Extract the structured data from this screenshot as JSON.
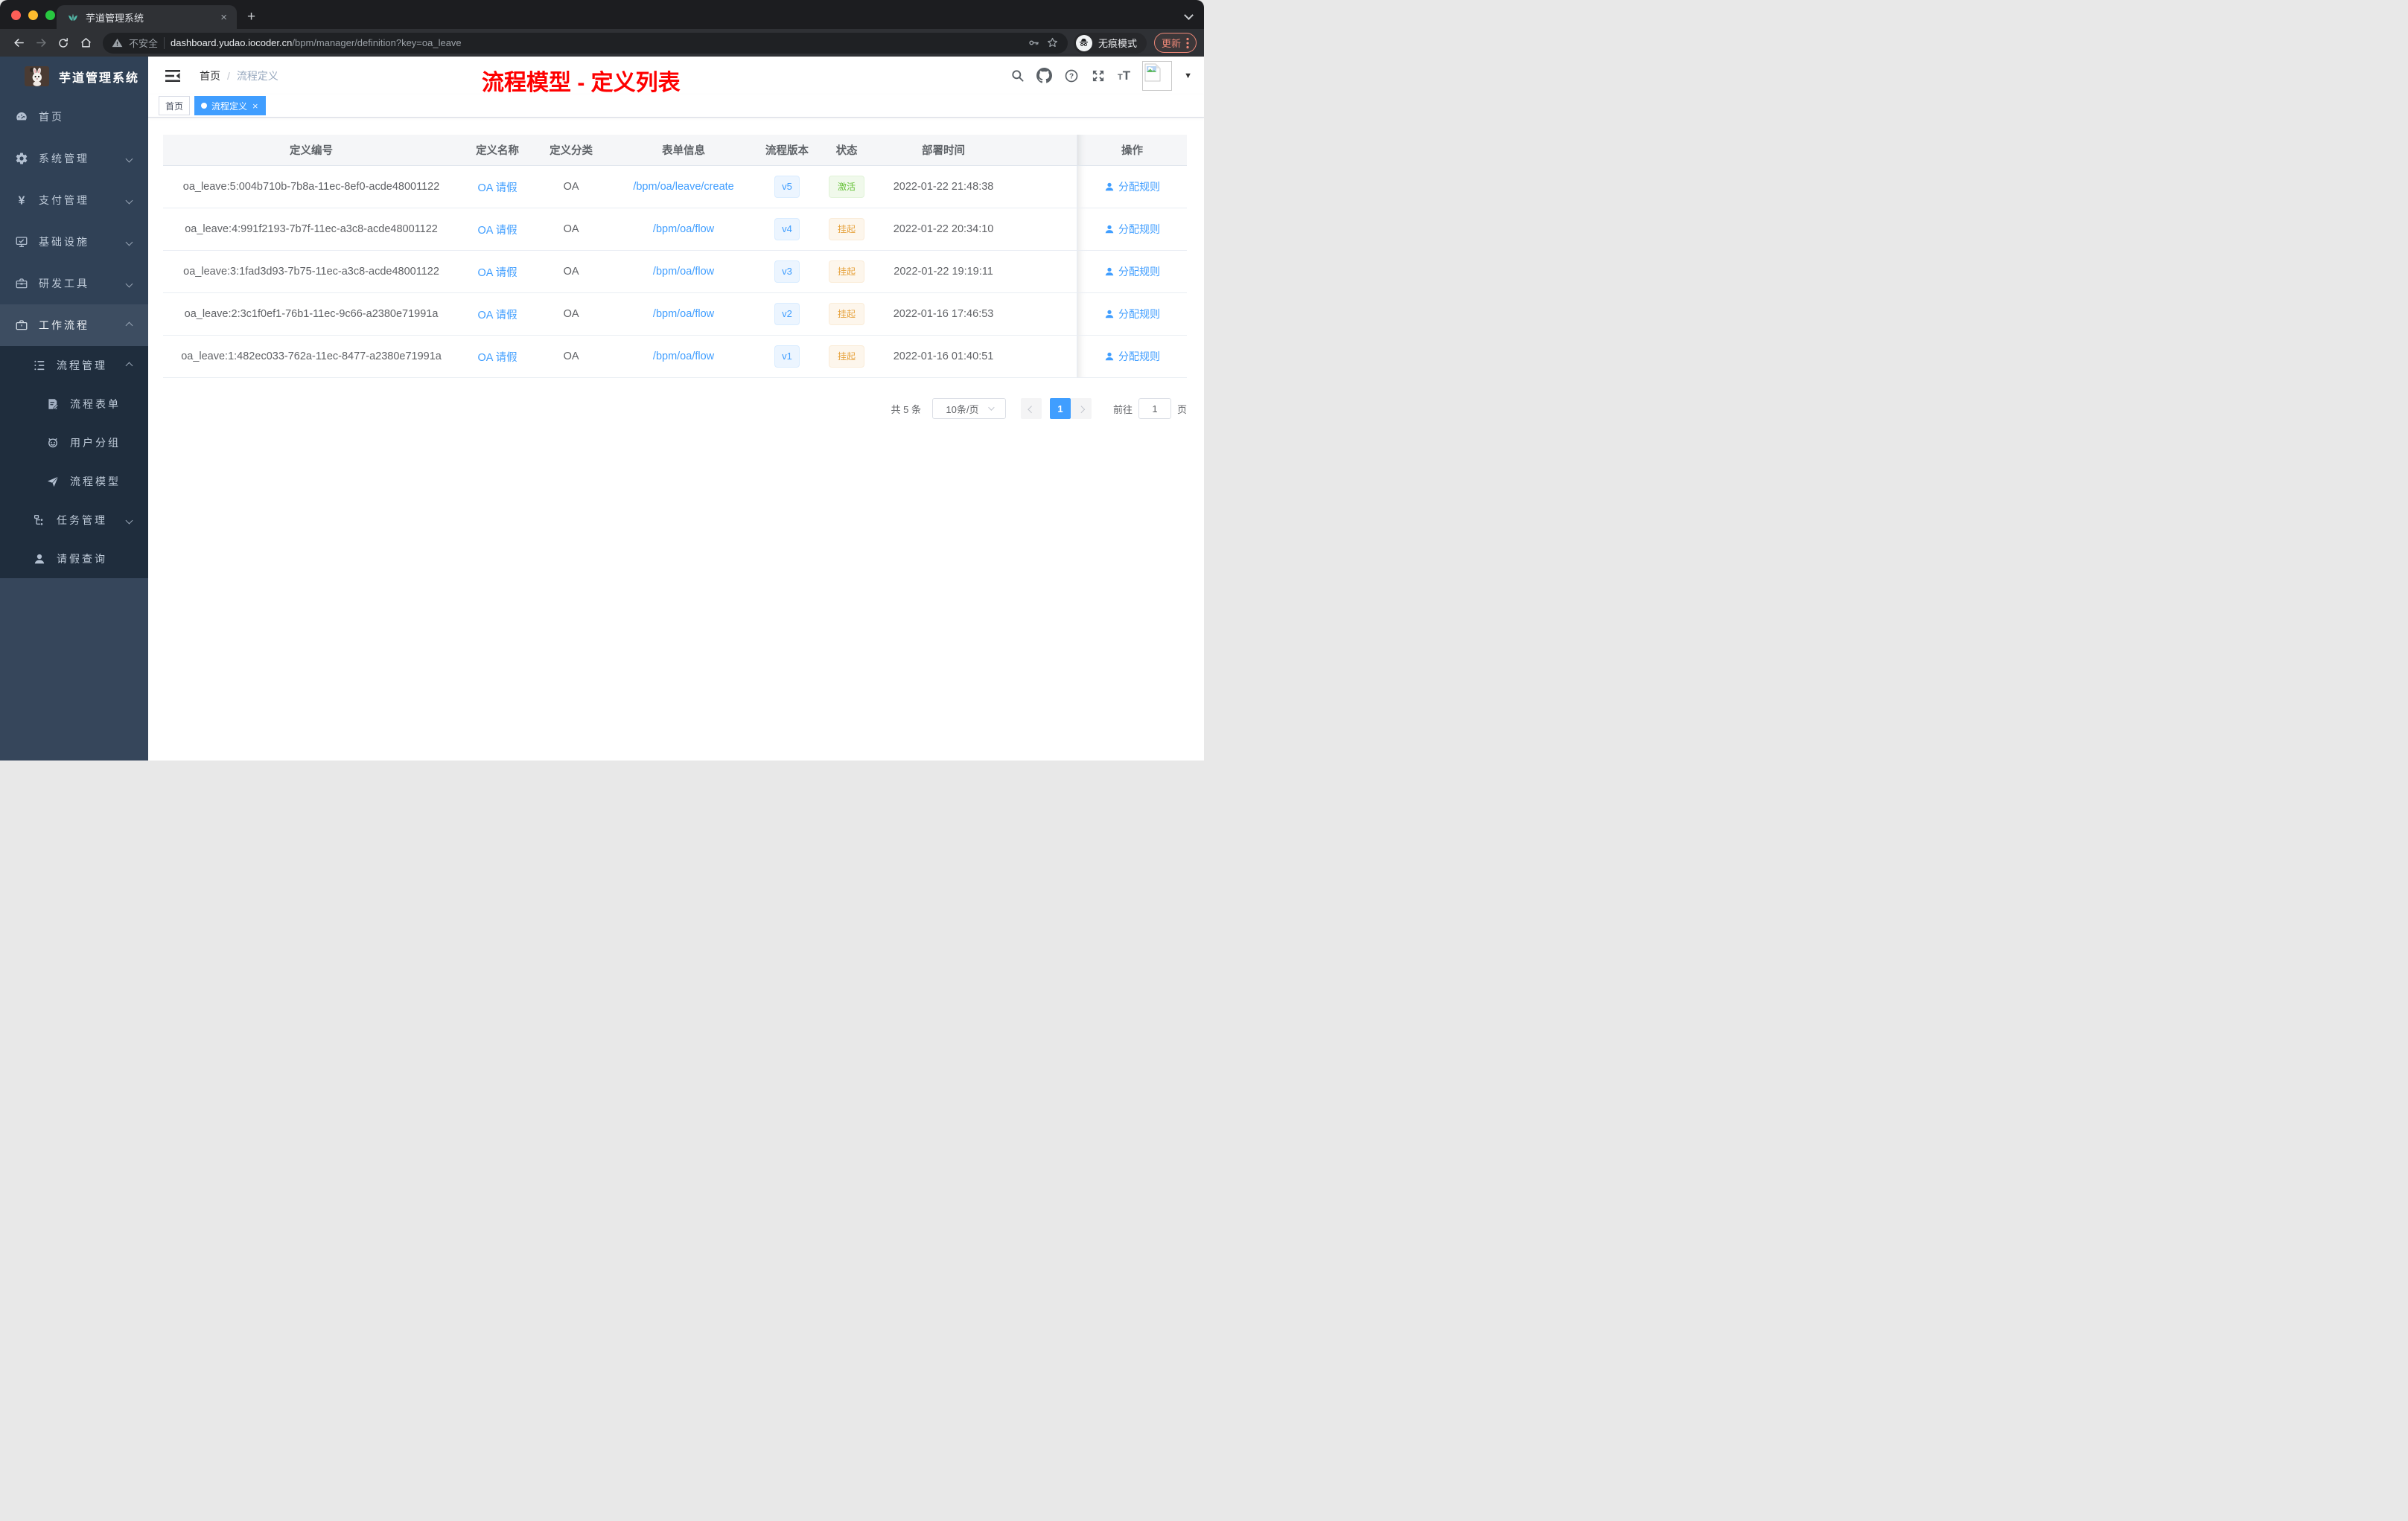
{
  "colors": {
    "accent": "#409eff",
    "annotation": "#fe0000",
    "sidebar_bg": "#304156",
    "submenu_bg": "#1f2d3d",
    "success": "#67c23a",
    "warning": "#e6a23c"
  },
  "browser": {
    "tab": {
      "title": "芋道管理系统",
      "close": "×"
    },
    "new_tab": "+",
    "url": {
      "security": "不安全",
      "host": "dashboard.yudao.iocoder.cn",
      "path": "/bpm/manager/definition?key=oa_leave"
    },
    "incognito_label": "无痕模式",
    "update_label": "更新"
  },
  "app": {
    "logo_title": "芋道管理系统",
    "breadcrumb": {
      "home": "首页",
      "separator": "/",
      "current": "流程定义"
    },
    "annotation": "流程模型 - 定义列表",
    "tags": [
      {
        "key": "home",
        "label": "首页",
        "active": false
      },
      {
        "key": "process-definition",
        "label": "流程定义",
        "active": true,
        "close": "×"
      }
    ]
  },
  "sidebar": {
    "items": [
      {
        "key": "home",
        "icon": "dashboard",
        "label": "首页"
      },
      {
        "key": "system",
        "icon": "gear",
        "label": "系统管理",
        "chevron": "down"
      },
      {
        "key": "payment",
        "icon": "yen",
        "label": "支付管理",
        "chevron": "down"
      },
      {
        "key": "infrastructure",
        "icon": "monitor",
        "label": "基础设施",
        "chevron": "down"
      },
      {
        "key": "devtools",
        "icon": "toolbox",
        "label": "研发工具",
        "chevron": "down"
      },
      {
        "key": "workflow",
        "icon": "briefcase",
        "label": "工作流程",
        "chevron": "up",
        "highlight": true,
        "children": [
          {
            "key": "process-management",
            "icon": "tree-list",
            "label": "流程管理",
            "chevron": "up",
            "children": [
              {
                "key": "process-form",
                "icon": "form",
                "label": "流程表单"
              },
              {
                "key": "user-group",
                "icon": "robot",
                "label": "用户分组"
              },
              {
                "key": "process-model",
                "icon": "send",
                "label": "流程模型"
              }
            ]
          },
          {
            "key": "task-management",
            "icon": "tree",
            "label": "任务管理",
            "chevron": "down"
          },
          {
            "key": "leave-query",
            "icon": "user",
            "label": "请假查询"
          }
        ]
      }
    ]
  },
  "table": {
    "columns": [
      {
        "key": "id",
        "label": "定义编号"
      },
      {
        "key": "name",
        "label": "定义名称"
      },
      {
        "key": "category",
        "label": "定义分类"
      },
      {
        "key": "form",
        "label": "表单信息"
      },
      {
        "key": "version",
        "label": "流程版本"
      },
      {
        "key": "status",
        "label": "状态"
      },
      {
        "key": "deploy-time",
        "label": "部署时间"
      },
      {
        "key": "actions",
        "label": "操作"
      }
    ],
    "rows": [
      {
        "id": "oa_leave:5:004b710b-7b8a-11ec-8ef0-acde48001122",
        "name": "OA 请假",
        "category": "OA",
        "form": "/bpm/oa/leave/create",
        "version": "v5",
        "status": "激活",
        "status_type": "success",
        "deployed_at": "2022-01-22 21:48:38",
        "action": "分配规则"
      },
      {
        "id": "oa_leave:4:991f2193-7b7f-11ec-a3c8-acde48001122",
        "name": "OA 请假",
        "category": "OA",
        "form": "/bpm/oa/flow",
        "version": "v4",
        "status": "挂起",
        "status_type": "warning",
        "deployed_at": "2022-01-22 20:34:10",
        "action": "分配规则"
      },
      {
        "id": "oa_leave:3:1fad3d93-7b75-11ec-a3c8-acde48001122",
        "name": "OA 请假",
        "category": "OA",
        "form": "/bpm/oa/flow",
        "version": "v3",
        "status": "挂起",
        "status_type": "warning",
        "deployed_at": "2022-01-22 19:19:11",
        "action": "分配规则"
      },
      {
        "id": "oa_leave:2:3c1f0ef1-76b1-11ec-9c66-a2380e71991a",
        "name": "OA 请假",
        "category": "OA",
        "form": "/bpm/oa/flow",
        "version": "v2",
        "status": "挂起",
        "status_type": "warning",
        "deployed_at": "2022-01-16 17:46:53",
        "action": "分配规则"
      },
      {
        "id": "oa_leave:1:482ec033-762a-11ec-8477-a2380e71991a",
        "name": "OA 请假",
        "category": "OA",
        "form": "/bpm/oa/flow",
        "version": "v1",
        "status": "挂起",
        "status_type": "warning",
        "deployed_at": "2022-01-16 01:40:51",
        "action": "分配规则"
      }
    ]
  },
  "pagination": {
    "total": "共 5 条",
    "page_size": "10条/页",
    "current_page": "1",
    "goto_label": "前往",
    "goto_value": "1",
    "page_unit": "页"
  }
}
